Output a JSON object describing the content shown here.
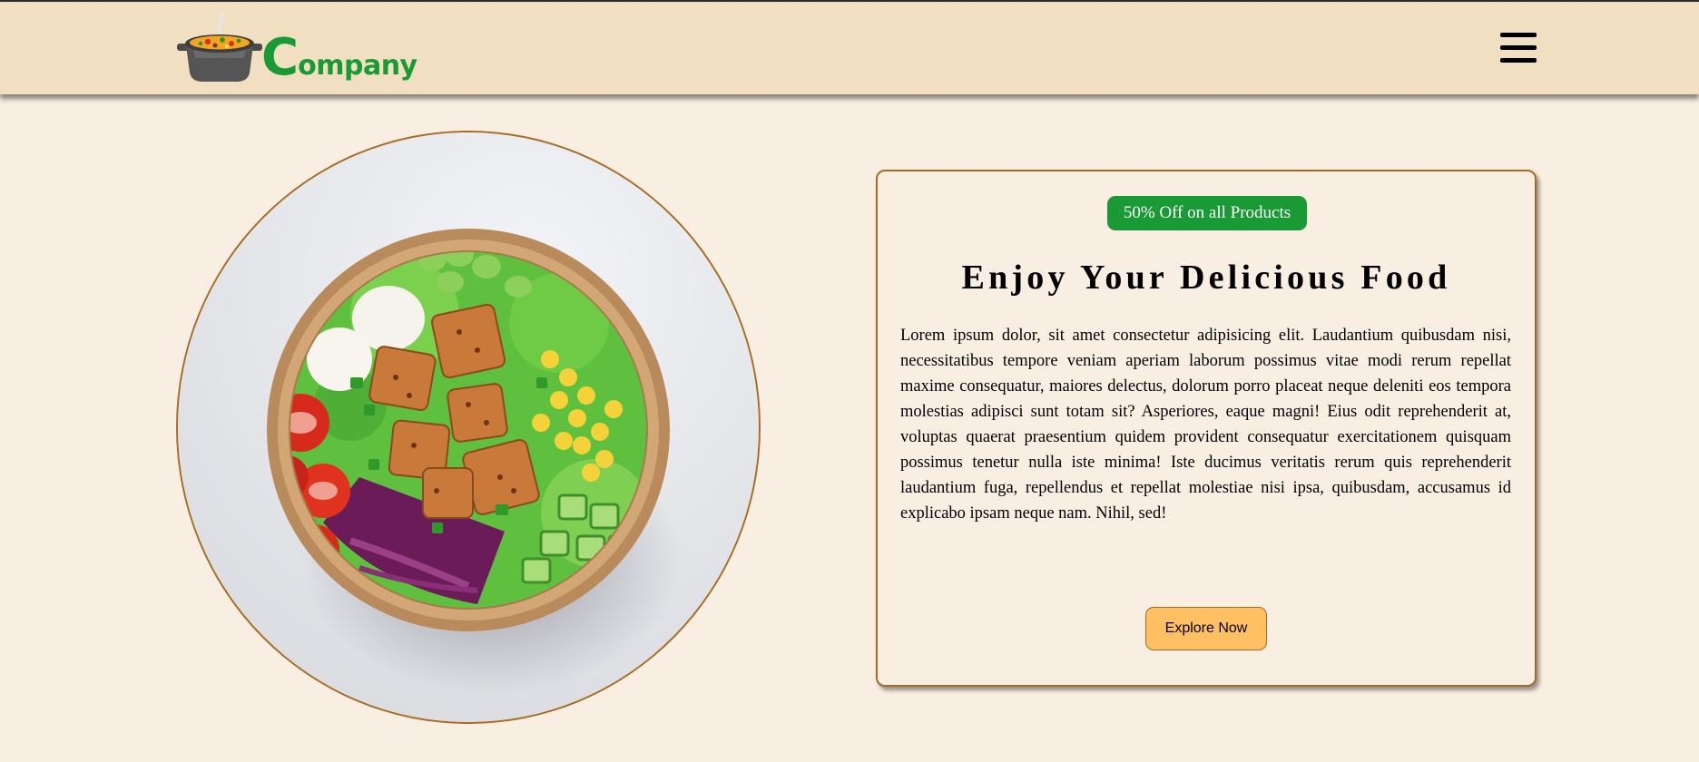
{
  "header": {
    "logo_text_initial": "C",
    "logo_text_rest": "ompany",
    "menu_icon": "hamburger-menu-icon"
  },
  "hero": {
    "image_description_icon": "salad-bowl-image"
  },
  "card": {
    "badge": "50% Off on all Products",
    "title": "Enjoy Your Delicious Food",
    "body": "Lorem ipsum dolor, sit amet consectetur adipisicing elit. Laudantium quibusdam nisi, necessitatibus tempore veniam aperiam laborum possimus vitae modi rerum repellat maxime consequatur, maiores delectus, dolorum porro placeat neque deleniti eos tempora molestias adipisci sunt totam sit? Asperiores, eaque magni! Eius odit reprehenderit at, voluptas quaerat praesentium quidem provident consequatur exercitationem quisquam possimus tenetur nulla iste minima! Iste ducimus veritatis rerum quis reprehenderit laudantium fuga, repellendus et repellat molestiae nisi ipsa, quibusdam, accusamus id explicabo ipsam neque nam. Nihil, sed!",
    "button_label": "Explore Now"
  },
  "colors": {
    "header_bg": "#f1dfc1",
    "page_bg": "#f8eee1",
    "brand_green": "#1a9a35",
    "accent_brown": "#a86b22",
    "button_orange": "#ffbf63"
  }
}
